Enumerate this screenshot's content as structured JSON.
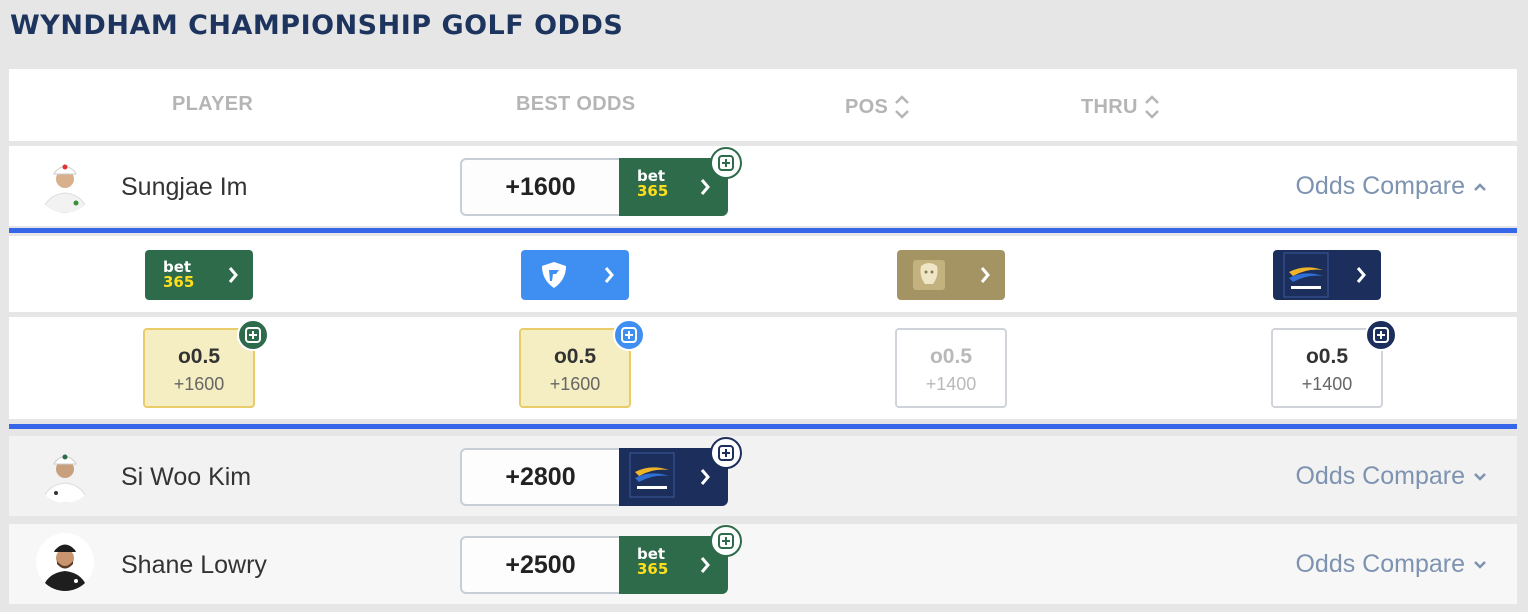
{
  "page_title": "WYNDHAM CHAMPIONSHIP GOLF ODDS",
  "columns": {
    "player": "PLAYER",
    "best_odds": "BEST ODDS",
    "pos": "POS",
    "thru": "THRU"
  },
  "players": [
    {
      "name": "Sungjae Im",
      "best_odds": "+1600",
      "book": "bet365",
      "compare_label": "Odds Compare",
      "expanded": true
    },
    {
      "name": "Si Woo Kim",
      "best_odds": "+2800",
      "book": "betrivers",
      "compare_label": "Odds Compare",
      "expanded": false
    },
    {
      "name": "Shane Lowry",
      "best_odds": "+2500",
      "book": "bet365",
      "compare_label": "Odds Compare",
      "expanded": false
    }
  ],
  "expanded_books": [
    {
      "book": "bet365",
      "icon": "bet365-logo-icon"
    },
    {
      "book": "fanduel",
      "icon": "fanduel-shield-icon"
    },
    {
      "book": "betmgm",
      "icon": "betmgm-lion-icon"
    },
    {
      "book": "betrivers",
      "icon": "betrivers-logo-icon"
    }
  ],
  "expanded_odds": [
    {
      "line": "o0.5",
      "price": "+1600",
      "state": "best"
    },
    {
      "line": "o0.5",
      "price": "+1600",
      "state": "best"
    },
    {
      "line": "o0.5",
      "price": "+1400",
      "state": "dim"
    },
    {
      "line": "o0.5",
      "price": "+1400",
      "state": "normal"
    }
  ],
  "bet365_logo": {
    "top": "bet",
    "bottom": "365"
  },
  "colors": {
    "accent_blue": "#3667e8",
    "bet365_green": "#2e6b4b",
    "betrivers_navy": "#1c2f5c",
    "fanduel_blue": "#3f8ff2",
    "betmgm_gold": "#a59463",
    "title_navy": "#1d355e"
  }
}
